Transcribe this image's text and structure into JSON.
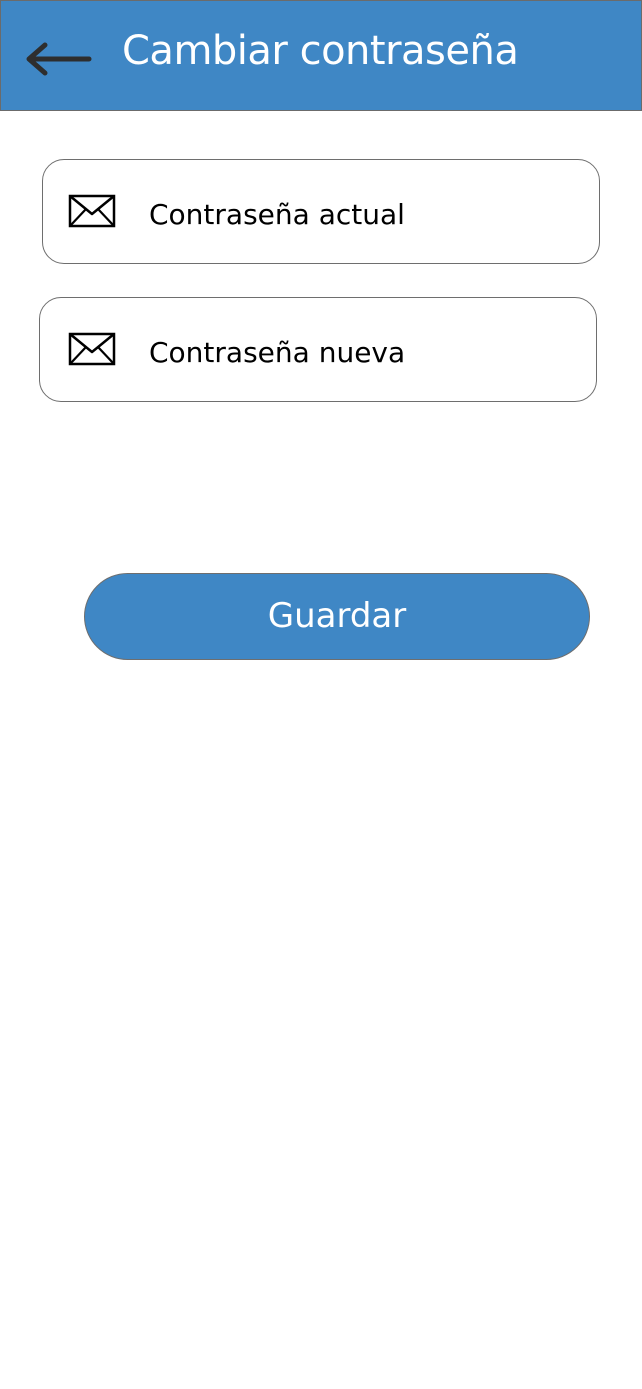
{
  "header": {
    "title": "Cambiar contraseña",
    "back_icon": "arrow-left-icon",
    "background_color": "#3f87c5"
  },
  "form": {
    "current_password": {
      "placeholder": "Contraseña actual",
      "value": "",
      "icon": "envelope-icon"
    },
    "new_password": {
      "placeholder": "Contraseña nueva",
      "value": "",
      "icon": "envelope-icon"
    }
  },
  "actions": {
    "save_label": "Guardar",
    "save_color": "#3f87c5"
  }
}
